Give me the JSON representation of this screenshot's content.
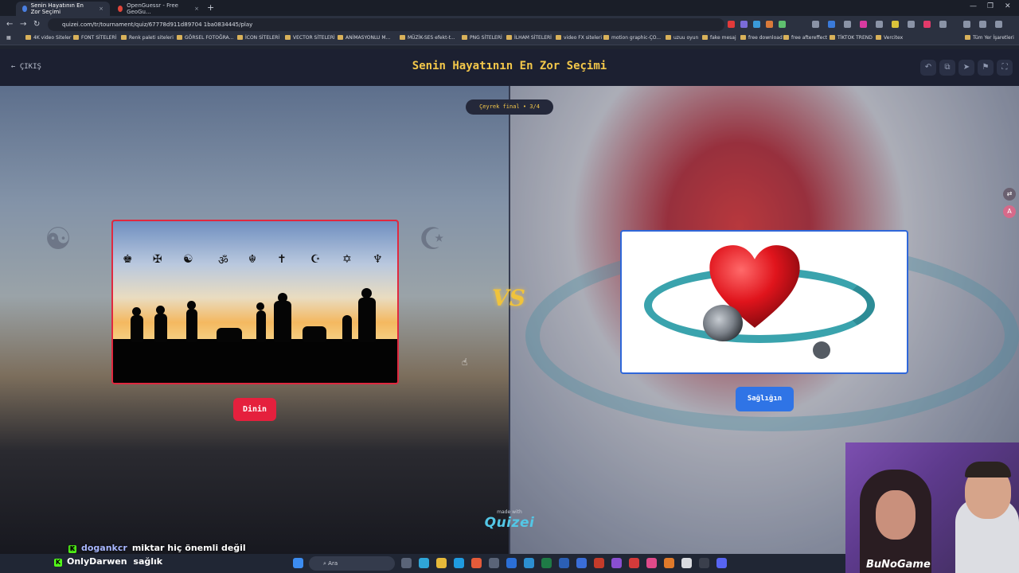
{
  "browser": {
    "tabs": [
      {
        "label": "Senin Hayatının En Zor Seçimi",
        "active": true,
        "color": "#4a7fe0"
      },
      {
        "label": "OpenGuessr - Free GeoGu...",
        "active": false,
        "color": "#e0453a"
      }
    ],
    "tab_close": "×",
    "new_tab": "+",
    "window_controls": [
      "—",
      "❐",
      "✕"
    ],
    "nav": {
      "back": "←",
      "forward": "→",
      "reload": "↻"
    },
    "url": "quizei.com/tr/tournament/quiz/67778d911d89704 1ba0834445/play",
    "bookmarks": [
      "4K video Siteler",
      "FONT SİTELERİ",
      "Renk paleti siteleri",
      "GÖRSEL FOTOĞRA...",
      "İCON SİTELERİ",
      "VECTOR SİTELERİ",
      "ANİMASYONLU M...",
      "MÜZİK-SES efekt-t...",
      "PNG SİTELERİ",
      "İLHAM SİTELERİ",
      "video FX siteleri",
      "motion graphic-ÇO...",
      "uzuu oyun",
      "fake mesaj",
      "free download",
      "free aftereffect",
      "TİKTOK TREND",
      "Vercitex",
      "Tüm Yer İşaretleri"
    ]
  },
  "app": {
    "exit_label": "ÇIKIŞ",
    "title": "Senin Hayatının En Zor Seçimi",
    "header_icons": [
      "undo-icon",
      "external-icon",
      "send-icon",
      "flag-icon",
      "fullscreen-icon"
    ],
    "round_label": "Çeyrek final • 3/4",
    "vs_label": "VS",
    "left_choice": {
      "label": "Dinin",
      "color": "#e5203d"
    },
    "right_choice": {
      "label": "Sağlığın",
      "color": "#2f74e6"
    },
    "made_with": "made with",
    "brand": "Quizei"
  },
  "overlay": {
    "chat": [
      {
        "user": "dogankcr",
        "message": "miktar hiç önemli değil"
      },
      {
        "user": "OnlyDarwen",
        "message": "sağlık"
      }
    ],
    "webcam_logo": "BuNoGame"
  },
  "taskbar": {
    "search_placeholder": "Ara"
  }
}
